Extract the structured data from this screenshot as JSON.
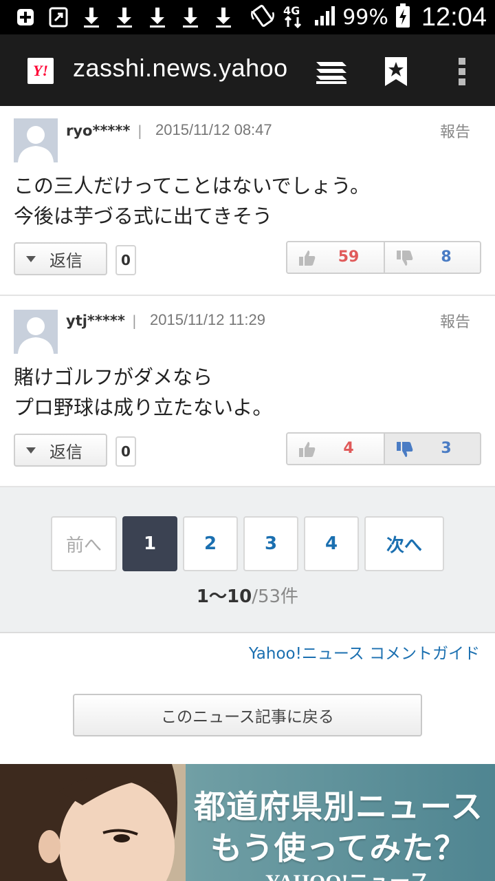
{
  "status_bar": {
    "battery_percent": "99%",
    "time": "12:04",
    "network": "4G",
    "icons": [
      "add-box-icon",
      "nfc-icon",
      "download-icon",
      "download-icon",
      "download-icon",
      "download-icon",
      "download-icon",
      "vibrate-icon",
      "network-4g-icon",
      "signal-icon",
      "battery-charging-icon"
    ]
  },
  "browser": {
    "logo": "Y!",
    "url": "zasshi.news.yahoo",
    "icons": [
      "tabs-icon",
      "bookmark-icon",
      "more-vert-icon"
    ]
  },
  "comments": [
    {
      "user": "ryo*****",
      "separator": "|",
      "date": "2015/11/12 08:47",
      "report": "報告",
      "text": "この三人だけってことはないでしょう。\n今後は芋づる式に出てきそう",
      "reply_label": "返信",
      "reply_count": "0",
      "good": "59",
      "bad": "8",
      "bad_active": false
    },
    {
      "user": "ytj*****",
      "separator": "|",
      "date": "2015/11/12 11:29",
      "report": "報告",
      "text": "賭けゴルフがダメなら\nプロ野球は成り立たないよ。",
      "reply_label": "返信",
      "reply_count": "0",
      "good": "4",
      "bad": "3",
      "bad_active": true
    }
  ],
  "pagination": {
    "prev": "前へ",
    "pages": [
      "1",
      "2",
      "3",
      "4"
    ],
    "current_page": "1",
    "next": "次へ",
    "range": "1〜10",
    "total": "/53件"
  },
  "guide_link": "Yahoo!ニュース コメントガイド",
  "back_button": "このニュース記事に戻る",
  "banner": {
    "line1": "都道府県別ニュース",
    "line2": "もう使ってみた？",
    "line3": "YAHOO!ニュース"
  },
  "colors": {
    "link": "#1a6fb0",
    "good": "#e05a5a",
    "bad": "#4a7cc4",
    "current_page": "#3b4252"
  }
}
